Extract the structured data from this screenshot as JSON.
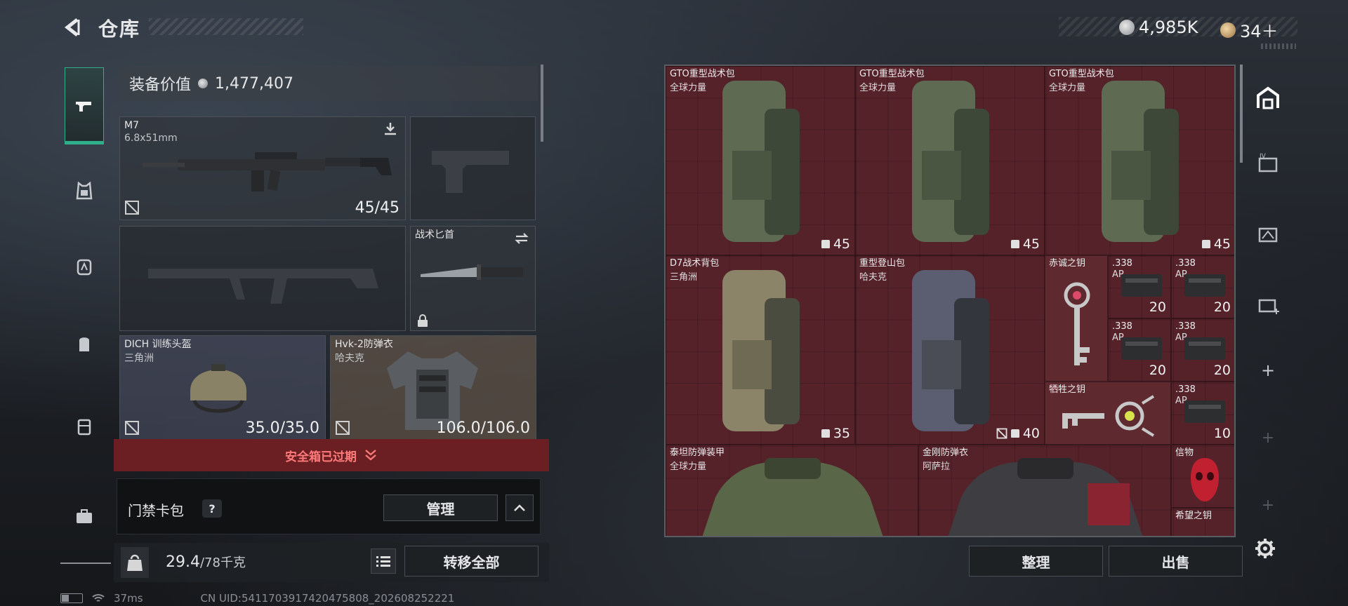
{
  "header": {
    "back_glyph": "<",
    "title": "仓库"
  },
  "currency": [
    {
      "icon": "silver-coin-icon",
      "value": "4,985K"
    },
    {
      "icon": "gold-coin-icon",
      "value": "34＋"
    }
  ],
  "equipment": {
    "value_label": "装备价值",
    "value": "1,477,407",
    "slots": {
      "primary": {
        "name": "M7",
        "sub": "6.8x51mm",
        "count": "45/45"
      },
      "melee": {
        "name": "战术匕首"
      },
      "helmet": {
        "name": "DICH 训练头盔",
        "sub": "三角洲",
        "durability": "35.0/35.0"
      },
      "armor": {
        "name": "Hvk-2防弹衣",
        "sub": "哈夫克",
        "durability": "106.0/106.0"
      }
    },
    "safe_box_text": "安全箱已过期",
    "card_bag_label": "门禁卡包",
    "card_bag_help": "?",
    "manage_label": "管理",
    "weight": "29.4",
    "weight_max": "/78千克",
    "transfer_all_label": "转移全部"
  },
  "status": {
    "ping": "37ms",
    "uid": "CN UID:5411703917420475808_202608252221"
  },
  "stash": {
    "items": [
      {
        "name": "GTO重型战术包",
        "sub": "全球力量",
        "count": "45"
      },
      {
        "name": "GTO重型战术包",
        "sub": "全球力量",
        "count": "45"
      },
      {
        "name": "GTO重型战术包",
        "sub": "全球力量",
        "count": "45"
      },
      {
        "name": "D7战术背包",
        "sub": "三角洲",
        "count": "35"
      },
      {
        "name": "重型登山包",
        "sub": "哈夫克",
        "count": "40"
      },
      {
        "name": "赤诚之钥"
      },
      {
        "name": ".338",
        "sub": "AP",
        "count": "20"
      },
      {
        "name": ".338",
        "sub": "AP",
        "count": "20"
      },
      {
        "name": ".338",
        "sub": "AP",
        "count": "20"
      },
      {
        "name": ".338",
        "sub": "AP",
        "count": "20"
      },
      {
        "name": "牺牲之钥"
      },
      {
        "name": ".338",
        "sub": "AP",
        "count": "10"
      },
      {
        "name": "泰坦防弹装甲",
        "sub": "全球力量"
      },
      {
        "name": "金刚防弹衣",
        "sub": "阿萨拉"
      },
      {
        "name": "信物"
      },
      {
        "name": "希望之钥"
      }
    ],
    "sort_label": "整理",
    "sell_label": "出售"
  },
  "colors": {
    "accent": "#2fae8a",
    "stash_bg": "#55222a",
    "warning": "#6b1f22"
  }
}
